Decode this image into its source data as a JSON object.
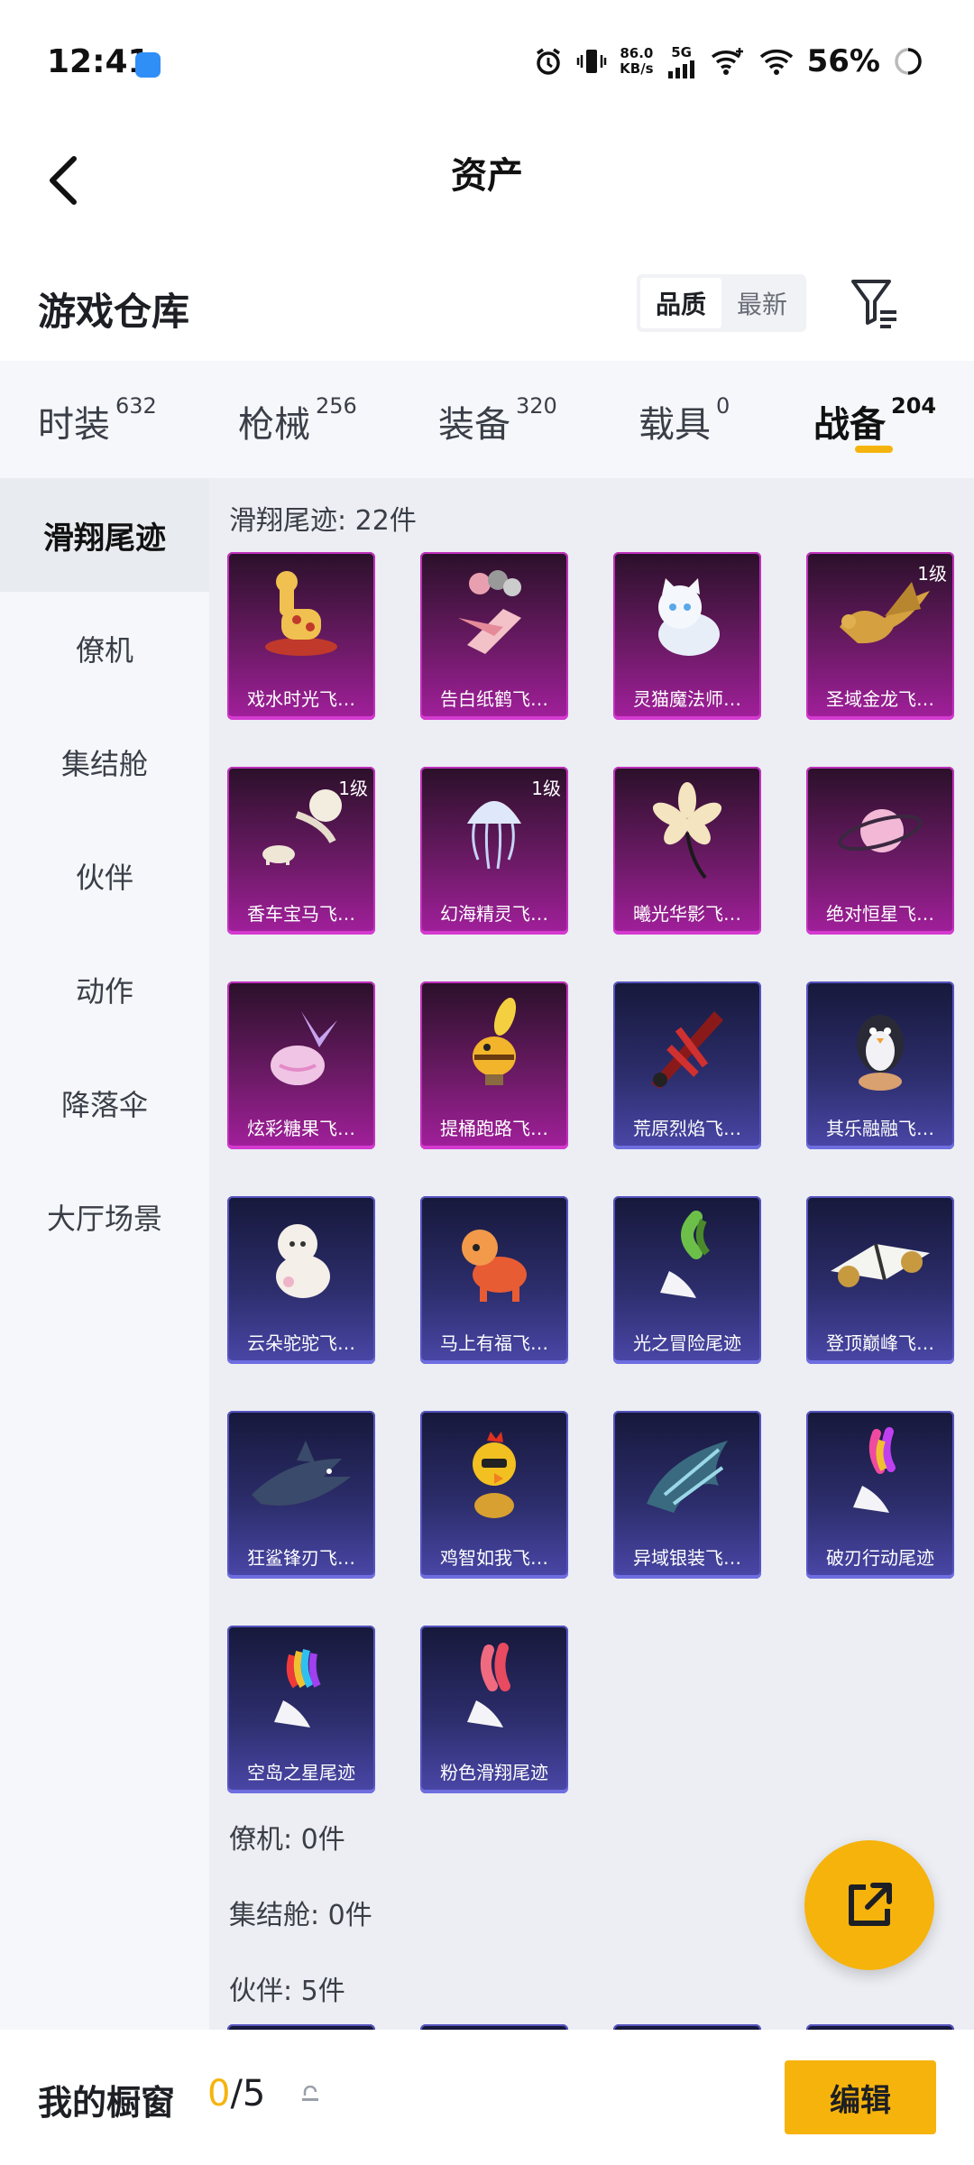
{
  "status_bar": {
    "time": "12:41",
    "net_speed_value": "86.0",
    "net_speed_unit": "KB/s",
    "network": "5G",
    "battery": "56%",
    "icons": [
      "alarm-icon",
      "vibrate-icon",
      "signal-icon",
      "wifi-plus-icon",
      "wifi-icon",
      "battery-icon"
    ]
  },
  "header": {
    "title": "资产"
  },
  "warehouse": {
    "title": "游戏仓库",
    "sort_options": [
      "品质",
      "最新"
    ],
    "sort_selected": "品质"
  },
  "category_tabs": [
    {
      "label": "时装",
      "count": "632",
      "active": false
    },
    {
      "label": "枪械",
      "count": "256",
      "active": false
    },
    {
      "label": "装备",
      "count": "320",
      "active": false
    },
    {
      "label": "载具",
      "count": "0",
      "active": false
    },
    {
      "label": "战备",
      "count": "204",
      "active": true
    }
  ],
  "sidebar": {
    "items": [
      "滑翔尾迹",
      "僚机",
      "集结舱",
      "伙伴",
      "动作",
      "降落伞",
      "大厅场景"
    ],
    "active_index": 0
  },
  "sections": {
    "glide_trail": {
      "header": "滑翔尾迹: 22件"
    },
    "wingman": {
      "header": "僚机: 0件"
    },
    "assembly": {
      "header": "集结舱: 0件"
    },
    "partner": {
      "header": "伙伴: 5件"
    }
  },
  "items": [
    {
      "name": "戏水时光飞…",
      "rarity": "purple",
      "level": "",
      "icon": "giraffe-toy-icon"
    },
    {
      "name": "告白纸鹤飞…",
      "rarity": "purple",
      "level": "",
      "icon": "paper-crane-icon"
    },
    {
      "name": "灵猫魔法师…",
      "rarity": "purple",
      "level": "",
      "icon": "white-cat-icon"
    },
    {
      "name": "圣域金龙飞…",
      "rarity": "purple",
      "level": "1级",
      "icon": "golden-dragon-icon"
    },
    {
      "name": "香车宝马飞…",
      "rarity": "purple",
      "level": "1级",
      "icon": "carriage-icon"
    },
    {
      "name": "幻海精灵飞…",
      "rarity": "purple",
      "level": "1级",
      "icon": "jellyfish-icon"
    },
    {
      "name": "曦光华影飞…",
      "rarity": "purple",
      "level": "",
      "icon": "flower-icon"
    },
    {
      "name": "绝对恒星飞…",
      "rarity": "purple",
      "level": "",
      "icon": "planet-icon"
    },
    {
      "name": "炫彩糖果飞…",
      "rarity": "purple",
      "level": "",
      "icon": "candy-icon"
    },
    {
      "name": "提桶跑路飞…",
      "rarity": "purple",
      "level": "",
      "icon": "bee-icon"
    },
    {
      "name": "荒原烈焰飞…",
      "rarity": "blue",
      "level": "",
      "icon": "flame-glider-icon"
    },
    {
      "name": "其乐融融飞…",
      "rarity": "blue",
      "level": "",
      "icon": "penguin-icon"
    },
    {
      "name": "云朵驼驼飞…",
      "rarity": "blue",
      "level": "",
      "icon": "alpaca-icon"
    },
    {
      "name": "马上有福飞…",
      "rarity": "blue",
      "level": "",
      "icon": "horse-toy-icon"
    },
    {
      "name": "光之冒险尾迹",
      "rarity": "blue",
      "level": "",
      "icon": "green-smoke-trail-icon"
    },
    {
      "name": "登顶巅峰飞…",
      "rarity": "blue",
      "level": "",
      "icon": "jet-glider-icon"
    },
    {
      "name": "狂鲨锋刃飞…",
      "rarity": "blue",
      "level": "",
      "icon": "shark-icon"
    },
    {
      "name": "鸡智如我飞…",
      "rarity": "blue",
      "level": "",
      "icon": "chicken-icon"
    },
    {
      "name": "异域银装飞…",
      "rarity": "blue",
      "level": "",
      "icon": "silver-wing-icon"
    },
    {
      "name": "破刃行动尾迹",
      "rarity": "blue",
      "level": "",
      "icon": "rainbow-smoke-trail-icon"
    },
    {
      "name": "空岛之星尾迹",
      "rarity": "blue",
      "level": "",
      "icon": "spectrum-smoke-trail-icon"
    },
    {
      "name": "粉色滑翔尾迹",
      "rarity": "blue",
      "level": "",
      "icon": "pink-smoke-trail-icon"
    }
  ],
  "showcase": {
    "label": "我的橱窗",
    "current": "0",
    "total": "/5"
  },
  "edit_button": "编辑",
  "colors": {
    "accent": "#f5b40d",
    "purple_card": "#a21f9c",
    "blue_card": "#4a47a8",
    "sidebar_bg": "#f5f7fa",
    "content_bg": "#eceef3"
  }
}
